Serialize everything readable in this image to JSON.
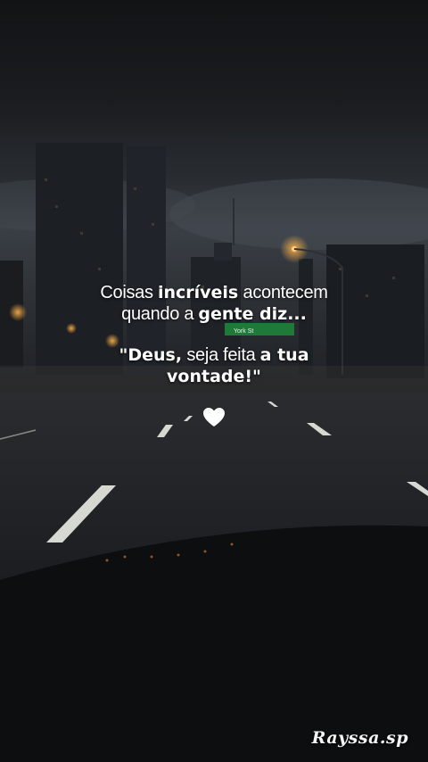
{
  "quote": {
    "line1": {
      "a": "Coisas ",
      "b": "incríveis",
      "c": " acontecem"
    },
    "line2": {
      "a": "quando a ",
      "b": "gente diz..."
    },
    "line3": {
      "a": "\"Deus,",
      "b": " seja feita ",
      "c": "a tua"
    },
    "line4": {
      "a": "vontade!\""
    }
  },
  "icons": {
    "heart": "white-heart-icon"
  },
  "signature": "Rayssa.sp",
  "road_sign": "York St",
  "colors": {
    "text": "#ffffff",
    "street_light": "#ffb347",
    "sign_green": "#1f7a3a"
  }
}
